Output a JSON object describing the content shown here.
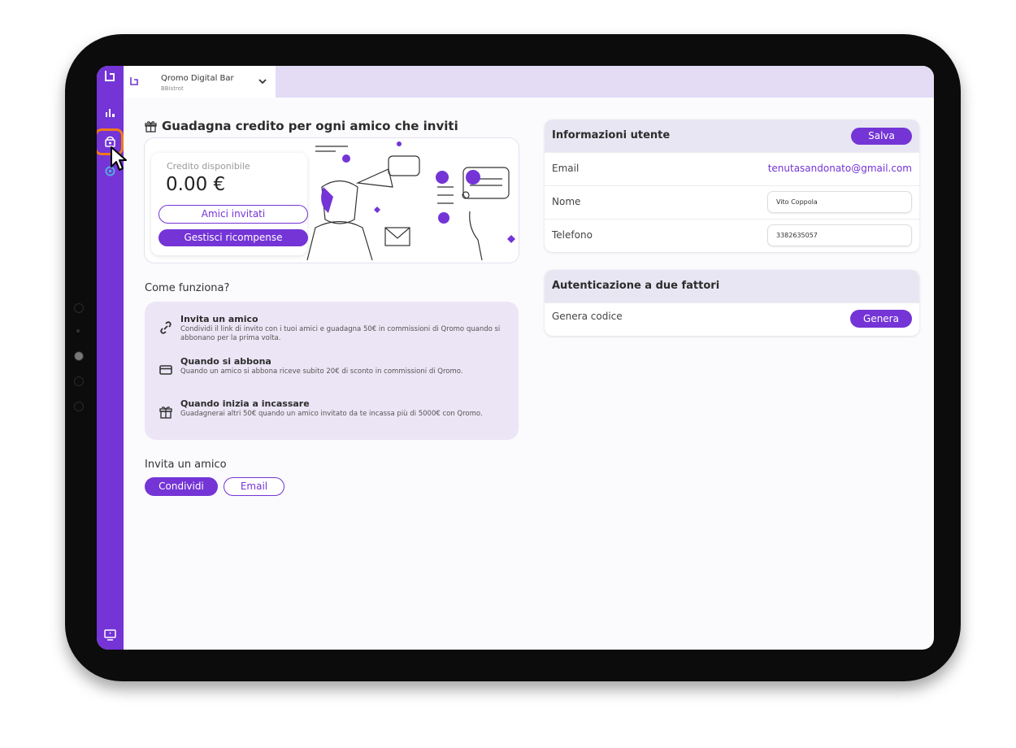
{
  "topbar": {
    "venue_name": "Qromo Digital Bar",
    "venue_sub": "BBistrot"
  },
  "referral": {
    "title": "Guadagna credito per ogni amico che inviti",
    "credit_label": "Credito disponibile",
    "credit_amount": "0.00 €",
    "invited_button": "Amici invitati",
    "rewards_button": "Gestisci ricompense"
  },
  "how": {
    "label": "Come funziona?",
    "steps": [
      {
        "title": "Invita un amico",
        "desc": "Condividi il link di invito con i tuoi amici e guadagna 50€ in commissioni di Qromo quando si abbonano per la prima volta."
      },
      {
        "title": "Quando si abbona",
        "desc": "Quando un amico si abbona riceve subito 20€ di sconto in commissioni di Qromo."
      },
      {
        "title": "Quando inizia a incassare",
        "desc": "Guadagnerai altri 50€ quando un amico invitato da te incassa più di 5000€ con Qromo."
      }
    ]
  },
  "invite": {
    "label": "Invita un amico",
    "share_button": "Condividi",
    "email_button": "Email"
  },
  "user_info": {
    "title": "Informazioni utente",
    "save_button": "Salva",
    "email_label": "Email",
    "email_value": "tenutasandonato@gmail.com",
    "name_label": "Nome",
    "name_value": "Vito Coppola",
    "phone_label": "Telefono",
    "phone_value": "3382635057"
  },
  "two_factor": {
    "title": "Autenticazione a due fattori",
    "row_label": "Genera codice",
    "button": "Genera"
  },
  "colors": {
    "accent": "#7434d6",
    "highlight": "#f07a1a",
    "panel_head": "#e8e6f2"
  },
  "icons": [
    "logo-icon",
    "analytics-icon",
    "referral-icon",
    "settings-icon",
    "display-icon",
    "chevron-down-icon",
    "link-icon",
    "card-icon",
    "gift-icon",
    "cursor-icon"
  ]
}
